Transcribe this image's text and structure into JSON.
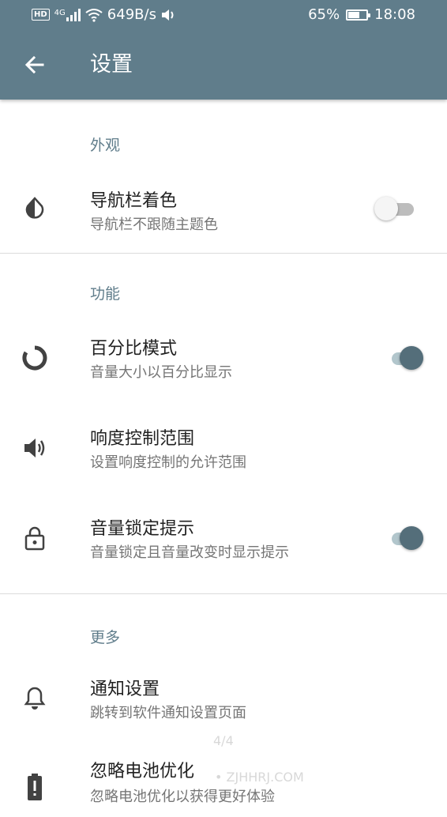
{
  "statusbar": {
    "hd": "HD",
    "net_type": "4G",
    "speed": "649B/s",
    "battery_percent": "65%",
    "battery_level": 0.65,
    "time": "18:08"
  },
  "appbar": {
    "title": "设置"
  },
  "sections": {
    "appearance": {
      "header": "外观",
      "nav_tint": {
        "title": "导航栏着色",
        "subtitle": "导航栏不跟随主题色",
        "enabled": false
      }
    },
    "function": {
      "header": "功能",
      "percent_mode": {
        "title": "百分比模式",
        "subtitle": "音量大小以百分比显示",
        "enabled": true
      },
      "loudness_range": {
        "title": "响度控制范围",
        "subtitle": "设置响度控制的允许范围"
      },
      "volume_lock_tip": {
        "title": "音量锁定提示",
        "subtitle": "音量锁定且音量改变时显示提示",
        "enabled": true
      }
    },
    "more": {
      "header": "更多",
      "notify_settings": {
        "title": "通知设置",
        "subtitle": "跳转到软件通知设置页面"
      },
      "battery_opt": {
        "title": "忽略电池优化",
        "subtitle": "忽略电池优化以获得更好体验"
      }
    }
  },
  "overlay": {
    "page_indicator": "4/4",
    "watermark": "• ZJHHRJ.COM"
  },
  "colors": {
    "primary": "#607d8b",
    "switch_on_thumb": "#546e7a",
    "switch_on_track": "#b2c6cc",
    "switch_off_thumb": "#f5f5f5",
    "switch_off_track": "#bdbdbd"
  }
}
